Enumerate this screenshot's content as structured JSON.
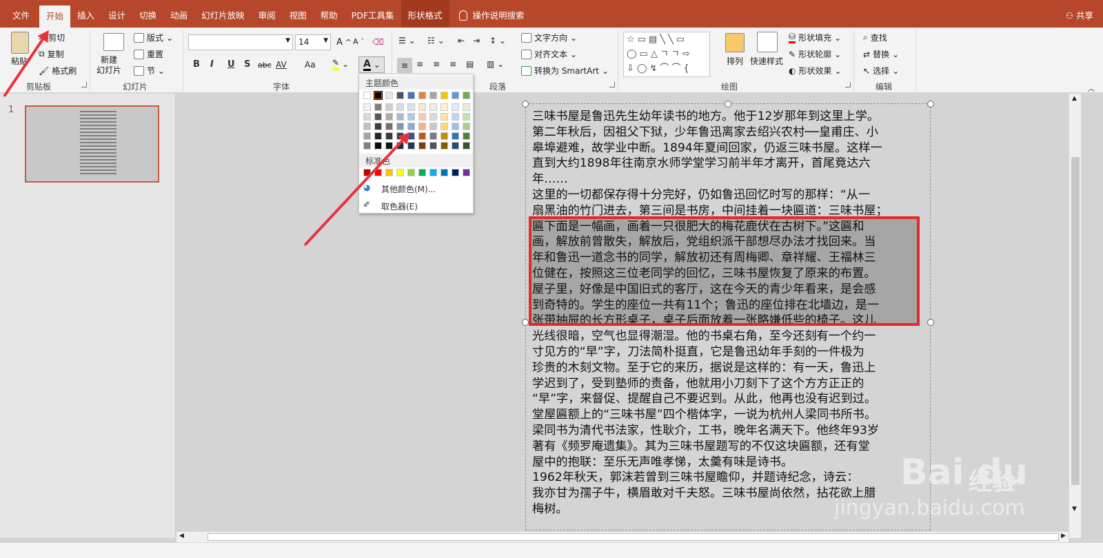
{
  "tabs": [
    "文件",
    "开始",
    "插入",
    "设计",
    "切换",
    "动画",
    "幻灯片放映",
    "审阅",
    "视图",
    "帮助",
    "PDF工具集",
    "形状格式"
  ],
  "tell_me": "操作说明搜索",
  "share": "共享",
  "clipboard": {
    "paste": "粘贴",
    "cut": "剪切",
    "copy": "复制",
    "painter": "格式刷",
    "label": "剪贴板"
  },
  "slides": {
    "new_slide": "新建\n幻灯片",
    "layout": "版式",
    "reset": "重置",
    "section": "节",
    "label": "幻灯片"
  },
  "font": {
    "name": "",
    "size": "14",
    "label": "字体",
    "bold": "B",
    "italic": "I",
    "underline": "U",
    "shadow": "S",
    "strike": "abc",
    "spacing": "AV",
    "case": "Aa",
    "color_letter": "A"
  },
  "paragraph": {
    "label": "段落",
    "text_direction": "文字方向",
    "align_text": "对齐文本",
    "smartart": "转换为 SmartArt"
  },
  "drawing": {
    "label": "绘图",
    "arrange": "排列",
    "quick_styles": "快速样式",
    "fill": "形状填充",
    "outline": "形状轮廓",
    "effects": "形状效果"
  },
  "editing": {
    "label": "编辑",
    "find": "查找",
    "replace": "替换",
    "select": "选择"
  },
  "slide_number": "1",
  "color_menu": {
    "theme_title": "主题颜色",
    "standard_title": "标准色",
    "more_colors": "其他颜色(M)...",
    "eyedropper": "取色器(E)",
    "theme_top": [
      "#ffffff",
      "#000000",
      "#e7e6e6",
      "#44546a",
      "#4472c4",
      "#ed7d31",
      "#a5a5a5",
      "#ffc000",
      "#5b9bd5",
      "#70ad47"
    ],
    "theme_shades": [
      [
        "#f2f2f2",
        "#7f7f7f",
        "#d0cece",
        "#d6dce4",
        "#d9e2f3",
        "#fbe4d5",
        "#ededed",
        "#fff2cc",
        "#deeaf6",
        "#e2efd9"
      ],
      [
        "#d8d8d8",
        "#595959",
        "#aeaaaa",
        "#adb9ca",
        "#b4c6e7",
        "#f7caac",
        "#dbdbdb",
        "#fee599",
        "#bdd6ee",
        "#c5e0b3"
      ],
      [
        "#bfbfbf",
        "#3f3f3f",
        "#757070",
        "#8496b0",
        "#8eaadb",
        "#f4b183",
        "#c9c9c9",
        "#ffd965",
        "#9cc3e5",
        "#a8d08d"
      ],
      [
        "#a5a5a5",
        "#262626",
        "#3a3838",
        "#323f4f",
        "#2f5496",
        "#c45911",
        "#7b7b7b",
        "#bf8f00",
        "#2e75b5",
        "#538135"
      ],
      [
        "#7f7f7f",
        "#0c0c0c",
        "#171616",
        "#222a35",
        "#1f3763",
        "#823b0b",
        "#525252",
        "#7f6000",
        "#1e4e79",
        "#375623"
      ]
    ],
    "standard": [
      "#c00000",
      "#ff0000",
      "#ffc000",
      "#ffff00",
      "#92d050",
      "#00b050",
      "#00b0f0",
      "#0070c0",
      "#002060",
      "#7030a0"
    ]
  },
  "slide_text": "三味书屋是鲁迅先生幼年读书的地方。他于12岁那年到这里上学。\n第二年秋后，因祖父下狱，少年鲁迅离家去绍兴农村──皇甫庄、小\n皋埠避难，故学业中断。1894年夏间回家，仍返三味书屋。这样一\n直到大约1898年往南京水师学堂学习前半年才离开，首尾竟达六\n年……\n这里的一切都保存得十分完好，仍如鲁迅回忆时写的那样：“从一\n扇黑油的竹门进去，第三间是书房，中间挂着一块匾道：三味书屋；\n匾下面是一幅画，画着一只很肥大的梅花鹿伏在古树下。”这匾和\n画，解放前曾散失，解放后，党组织派干部想尽办法才找回来。当\n年和鲁迅一道念书的同学，解放初还有周梅卿、章祥耀、王福林三\n位健在，按照这三位老同学的回忆，三味书屋恢复了原来的布置。\n屋子里，好像是中国旧式的客厅，这在今天的青少年看来，是会感\n到奇特的。学生的座位一共有11个；鲁迅的座位排在北墙边，是一\n张带抽屉的长方形桌子，桌子后面放着一张略嫌低些的椅子。这儿\n光线很暗，空气也显得潮湿。他的书桌右角，至今还刻有一个约一\n寸见方的“早”字，刀法简朴挺直，它是鲁迅幼年手刻的一件极为\n珍贵的木刻文物。至于它的来历，据说是这样的：有一天，鲁迅上\n学迟到了，受到塾师的责备，他就用小刀刻下了这个方方正正的\n“早”字，来督促、提醒自己不要迟到。从此，他再也没有迟到过。\n堂屋匾额上的“三味书屋”四个楷体字，一说为杭州人梁同书所书。\n梁同书为清代书法家，性耿介，工书，晚年名满天下。他终年93岁\n著有《频罗庵遗集》。其为三味书屋题写的不仅这块匾额，还有堂\n屋中的抱联：至乐无声唯孝悌，太羹有味是诗书。\n1962年秋天，郭沫若曾到三味书屋瞻仰，并题诗纪念，诗云：\n我亦甘为孺子牛，横眉敢对千夫怒。三味书屋尚依然，拈花欲上腊\n梅树。",
  "watermark": {
    "logo": "Bai du",
    "brand": "经验",
    "url": "jingyan.baidu.com"
  }
}
